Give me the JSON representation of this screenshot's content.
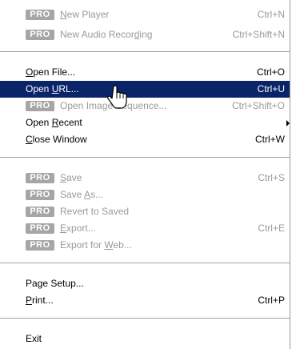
{
  "badge": "PRO",
  "items": [
    {
      "id": "new-player",
      "pre": "",
      "ul": "N",
      "post": "ew Player",
      "shortcut": "Ctrl+N",
      "pro": true,
      "disabled": true
    },
    {
      "id": "new-audio-recording",
      "pre": "New Audio Recor",
      "ul": "d",
      "post": "ing",
      "shortcut": "Ctrl+Shift+N",
      "pro": true,
      "disabled": true
    },
    {
      "id": "open-file",
      "pre": "",
      "ul": "O",
      "post": "pen File...",
      "shortcut": "Ctrl+O",
      "pro": false,
      "disabled": false
    },
    {
      "id": "open-url",
      "pre": "Open ",
      "ul": "U",
      "post": "RL...",
      "shortcut": "Ctrl+U",
      "pro": false,
      "disabled": false,
      "selected": true
    },
    {
      "id": "open-image-sequence",
      "pre": "Open Image Sequence...",
      "ul": "",
      "post": "",
      "shortcut": "Ctrl+Shift+O",
      "pro": true,
      "disabled": true
    },
    {
      "id": "open-recent",
      "pre": "Open ",
      "ul": "R",
      "post": "ecent",
      "shortcut": "",
      "pro": false,
      "disabled": false,
      "submenu": true
    },
    {
      "id": "close-window",
      "pre": "",
      "ul": "C",
      "post": "lose Window",
      "shortcut": "Ctrl+W",
      "pro": false,
      "disabled": false
    },
    {
      "id": "save",
      "pre": "",
      "ul": "S",
      "post": "ave",
      "shortcut": "Ctrl+S",
      "pro": true,
      "disabled": true
    },
    {
      "id": "save-as",
      "pre": "Save ",
      "ul": "A",
      "post": "s...",
      "shortcut": "",
      "pro": true,
      "disabled": true
    },
    {
      "id": "revert-to-saved",
      "pre": "Revert to Saved",
      "ul": "",
      "post": "",
      "shortcut": "",
      "pro": true,
      "disabled": true
    },
    {
      "id": "export",
      "pre": "",
      "ul": "E",
      "post": "xport...",
      "shortcut": "Ctrl+E",
      "pro": true,
      "disabled": true
    },
    {
      "id": "export-for-web",
      "pre": "Export for ",
      "ul": "W",
      "post": "eb...",
      "shortcut": "",
      "pro": true,
      "disabled": true
    },
    {
      "id": "page-setup",
      "pre": "Pa",
      "ul": "g",
      "post": "e Setup...",
      "shortcut": "",
      "pro": false,
      "disabled": false
    },
    {
      "id": "print",
      "pre": "",
      "ul": "P",
      "post": "rint...",
      "shortcut": "Ctrl+P",
      "pro": false,
      "disabled": false
    },
    {
      "id": "exit",
      "pre": "Exit",
      "ul": "",
      "post": "",
      "shortcut": "",
      "pro": false,
      "disabled": false
    }
  ],
  "cursor_icon": "hand-pointer-icon"
}
